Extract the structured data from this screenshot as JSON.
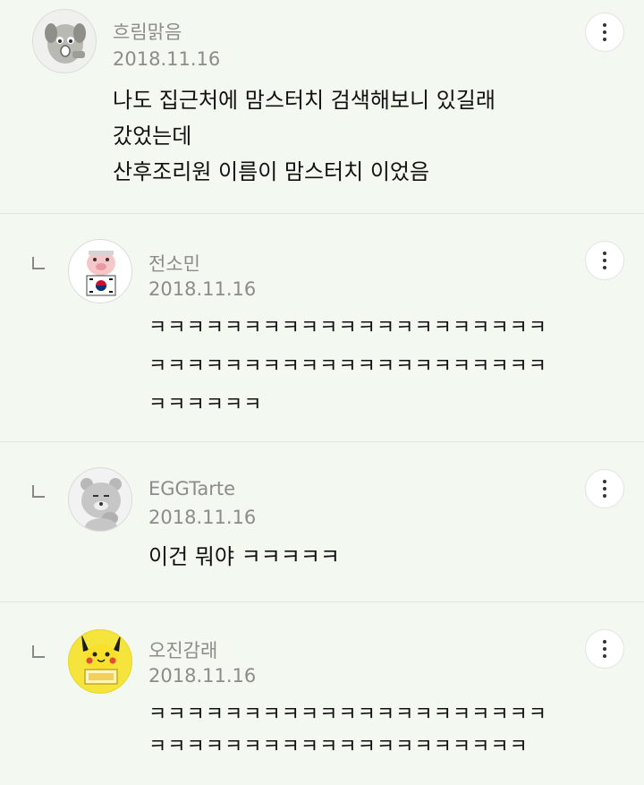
{
  "comments": [
    {
      "author": "흐림맑음",
      "date": "2018.11.16",
      "lines": [
        "나도 집근처에 맘스터치 검색해보니 있길래",
        "갔었는데",
        "산후조리원 이름이 맘스터치 이었음"
      ],
      "avatar_icon": "dog-character-icon",
      "is_reply": false
    },
    {
      "author": "전소민",
      "date": "2018.11.16",
      "lines": [
        "ㅋㅋㅋㅋㅋㅋㅋㅋㅋㅋㅋㅋㅋㅋㅋㅋㅋㅋㅋㅋㅋ",
        "ㅋㅋㅋㅋㅋㅋㅋㅋㅋㅋㅋㅋㅋㅋㅋㅋㅋㅋㅋㅋㅋ",
        "ㅋㅋㅋㅋㅋㅋ"
      ],
      "avatar_icon": "pig-korea-flag-icon",
      "is_reply": true
    },
    {
      "author": "EGGTarte",
      "date": "2018.11.16",
      "lines": [
        "이건 뭐야 ㅋㅋㅋㅋㅋ"
      ],
      "avatar_icon": "bear-character-icon",
      "is_reply": true
    },
    {
      "author": "오진감래",
      "date": "2018.11.16",
      "lines": [
        "ㅋㅋㅋㅋㅋㅋㅋㅋㅋㅋㅋㅋㅋㅋㅋㅋㅋㅋㅋㅋㅋ",
        "ㅋㅋㅋㅋㅋㅋㅋㅋㅋㅋㅋㅋㅋㅋㅋㅋㅋㅋㅋㅋ"
      ],
      "avatar_icon": "pikachu-icon",
      "is_reply": true
    }
  ],
  "colors": {
    "background": "#f3f8f0",
    "meta_text": "#8c8c8c",
    "body_text": "#111111",
    "pikachu_yellow": "#f5e43c"
  }
}
